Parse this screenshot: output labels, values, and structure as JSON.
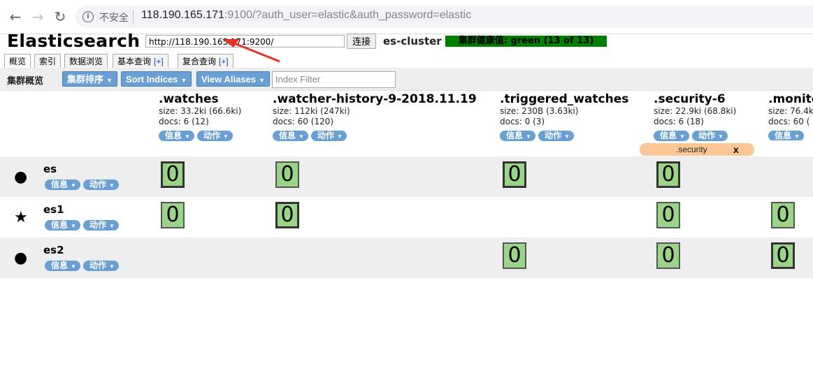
{
  "browser": {
    "back_icon": "arrow-left-icon",
    "forward_icon": "arrow-right-icon",
    "reload_icon": "reload-icon",
    "security_label": "不安全",
    "url_host": "118.190.165.171",
    "url_rest": ":9100/?auth_user=elastic&auth_password=elastic"
  },
  "header": {
    "title": "Elasticsearch",
    "connect_url": "http://118.190.165.171:9200/",
    "connect_button": "连接",
    "cluster_name": "es-cluster",
    "health_text": "集群健康值: green (13 of 13)",
    "health_color": "#008000"
  },
  "tabs": [
    {
      "label": "概览"
    },
    {
      "label": "索引"
    },
    {
      "label": "数据浏览"
    },
    {
      "label": "基本查询",
      "plus": "[+]"
    },
    {
      "label": "复合查询",
      "plus": "[+]"
    }
  ],
  "toolbar": {
    "label": "集群概览",
    "sort_cluster": "集群排序",
    "sort_indices": "Sort Indices",
    "view_aliases": "View Aliases",
    "filter_placeholder": "Index Filter"
  },
  "pill_labels": {
    "info": "信息",
    "action": "动作"
  },
  "indices": [
    {
      "name": ".watches",
      "size": "size: 33.2ki (66.6ki)",
      "docs": "docs: 6 (12)"
    },
    {
      "name": ".watcher-history-9-2018.11.19",
      "size": "size: 112ki (247ki)",
      "docs": "docs: 60 (120)"
    },
    {
      "name": ".triggered_watches",
      "size": "size: 230B (3.63ki)",
      "docs": "docs: 0 (3)"
    },
    {
      "name": ".security-6",
      "size": "size: 22.9ki (68.8ki)",
      "docs": "docs: 6 (18)"
    },
    {
      "name": ".monito",
      "size": "size: 76.4k",
      "docs": "docs: 60 ("
    }
  ],
  "alias": {
    "name": ".security",
    "close": "x",
    "color": "#fbc796"
  },
  "nodes": [
    {
      "name": "es",
      "marker": "●",
      "marker_icon": "circle-icon"
    },
    {
      "name": "es1",
      "marker": "★",
      "marker_icon": "star-icon"
    },
    {
      "name": "es2",
      "marker": "●",
      "marker_icon": "circle-icon"
    }
  ],
  "shard_value": "0",
  "colors": {
    "shard_green": "#9ad587",
    "button_blue": "#6a9fd3",
    "annotation_red": "#e8302a"
  }
}
